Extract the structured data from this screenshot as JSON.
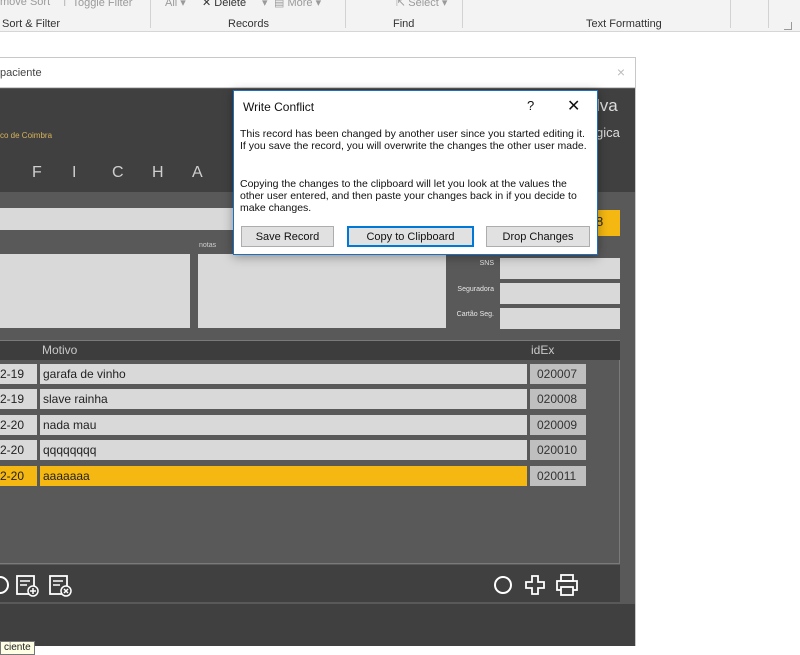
{
  "ribbon": {
    "items": {
      "remove_sort": "move Sort",
      "toggle_filter": "Toggle Filter",
      "all": "All ▾",
      "delete": "Delete",
      "more": "More ▾",
      "select": "Select ▾"
    },
    "groups": {
      "sort_filter": "Sort & Filter",
      "records": "Records",
      "find": "Find",
      "text_formatting": "Text Formatting"
    }
  },
  "form": {
    "title": "paciente",
    "close_glyph": "×",
    "subtitle": "co de Coimbra",
    "name_suffix": "lva",
    "spec_suffix": "gica",
    "ficha_letters": [
      "F",
      "I",
      "C",
      "H",
      "A"
    ],
    "yellow_value": "8",
    "notas_label": "notas",
    "side_labels": {
      "sns": "SNS",
      "seguradora": "Seguradora",
      "cartao": "Cartão Seg."
    }
  },
  "table": {
    "headers": {
      "motivo": "Motivo",
      "idex": "idEx"
    },
    "rows": [
      {
        "date": "2-19",
        "motivo": "garafa de vinho",
        "id": "020007"
      },
      {
        "date": "2-19",
        "motivo": "slave rainha",
        "id": "020008"
      },
      {
        "date": "2-20",
        "motivo": "nada mau",
        "id": "020009"
      },
      {
        "date": "2-20",
        "motivo": "qqqqqqqq",
        "id": "020010"
      },
      {
        "date": "2-20",
        "motivo": "aaaaaaa",
        "id": "020011"
      }
    ],
    "selected_index": 4
  },
  "tooltip": "ciente",
  "dialog": {
    "title": "Write Conflict",
    "help_glyph": "?",
    "close_glyph": "✕",
    "message1": "This record has been changed by another user since you started editing it. If you save the record, you will overwrite the changes the other user made.",
    "message2": "Copying the changes to the clipboard will let you look at the values the other user entered, and then paste your changes back in if you decide to make changes.",
    "buttons": {
      "save": "Save Record",
      "copy": "Copy to Clipboard",
      "drop": "Drop Changes"
    }
  },
  "colors": {
    "accent": "#f5b812",
    "dialog_border": "#1e6fc2",
    "form_bg": "#595959",
    "band_bg": "#404040"
  }
}
